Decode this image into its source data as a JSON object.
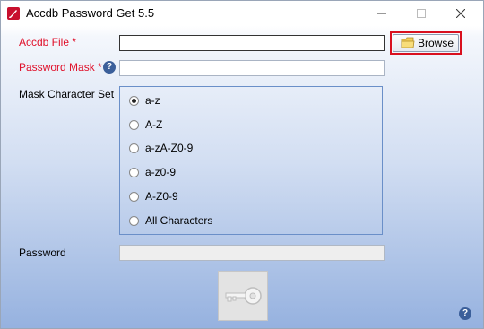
{
  "window": {
    "title": "Accdb Password Get 5.5",
    "icon": "app-icon-quill",
    "minimize_glyph": "—",
    "maximize_glyph": "☐",
    "close_glyph": "✕"
  },
  "form": {
    "file_label_prefix": "Accdb File",
    "file_required_mark": "*",
    "file_value": "",
    "browse_label": "Browse",
    "mask_label_prefix": "Password Mask",
    "mask_required_mark": "*",
    "mask_value": "",
    "charset_label": "Mask Character Set",
    "charset_options": [
      {
        "label": "a-z",
        "selected": true
      },
      {
        "label": "A-Z",
        "selected": false
      },
      {
        "label": "a-zA-Z0-9",
        "selected": false
      },
      {
        "label": "a-z0-9",
        "selected": false
      },
      {
        "label": "A-Z0-9",
        "selected": false
      },
      {
        "label": "All Characters",
        "selected": false
      }
    ],
    "password_label": "Password",
    "password_value": ""
  },
  "colors": {
    "required": "#e0102a",
    "highlight_outline": "#d9101e",
    "group_border": "#6a8fc8",
    "help_icon": "#3b5f9a"
  }
}
